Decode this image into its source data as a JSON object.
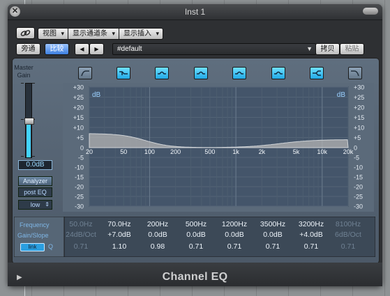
{
  "window": {
    "title": "Inst 1"
  },
  "toolbar": {
    "link_icon": "link-icon",
    "view_menu": "视图",
    "show_channel": "显示通道条",
    "show_insert": "显示插入",
    "bypass": "旁通",
    "compare": "比较",
    "prev": "◀",
    "next": "▶",
    "preset": "#default",
    "copy": "拷贝",
    "paste": "粘贴"
  },
  "master": {
    "label": "Master Gain",
    "value": "0.0dB",
    "fader_level_fraction": 0.5
  },
  "analyzer": {
    "label": "Analyzer",
    "mode": "post EQ",
    "resolution": "low"
  },
  "graph": {
    "db_unit": "dB",
    "db_ticks_top": [
      "+30",
      "+25",
      "+20",
      "+15",
      "+10",
      "+5",
      "0"
    ],
    "db_ticks_bottom": [
      "-5",
      "-10",
      "-15",
      "-20",
      "-25",
      "-30"
    ],
    "freq_ticks": [
      "20",
      "50",
      "100",
      "200",
      "500",
      "1k",
      "2k",
      "5k",
      "10k",
      "20k"
    ],
    "colors": {
      "curve_fill": "#b4b4b4",
      "graph_bg": "#44556a",
      "accent": "#2ec9ff"
    }
  },
  "bands": {
    "icons": [
      "low-cut-icon",
      "low-shelf-icon",
      "parametric-icon",
      "parametric-icon",
      "parametric-icon",
      "parametric-icon",
      "high-shelf-icon",
      "high-cut-icon"
    ],
    "labels": {
      "frequency": "Frequency",
      "gain_slope": "Gain/Slope",
      "q": "Q",
      "link_button": "link"
    },
    "values": [
      {
        "freq": "50.0Hz",
        "gain": "24dB/Oct",
        "q": "0.71",
        "active": false
      },
      {
        "freq": "70.0Hz",
        "gain": "+7.0dB",
        "q": "1.10",
        "active": true
      },
      {
        "freq": "200Hz",
        "gain": "0.0dB",
        "q": "0.98",
        "active": true
      },
      {
        "freq": "500Hz",
        "gain": "0.0dB",
        "q": "0.71",
        "active": true
      },
      {
        "freq": "1200Hz",
        "gain": "0.0dB",
        "q": "0.71",
        "active": true
      },
      {
        "freq": "3500Hz",
        "gain": "0.0dB",
        "q": "0.71",
        "active": true
      },
      {
        "freq": "3200Hz",
        "gain": "+4.0dB",
        "q": "0.71",
        "active": true
      },
      {
        "freq": "8100Hz",
        "gain": "6dB/Oct",
        "q": "0.71",
        "active": false
      }
    ]
  },
  "footer": {
    "plugin_name": "Channel EQ",
    "disclosure": "▶"
  }
}
